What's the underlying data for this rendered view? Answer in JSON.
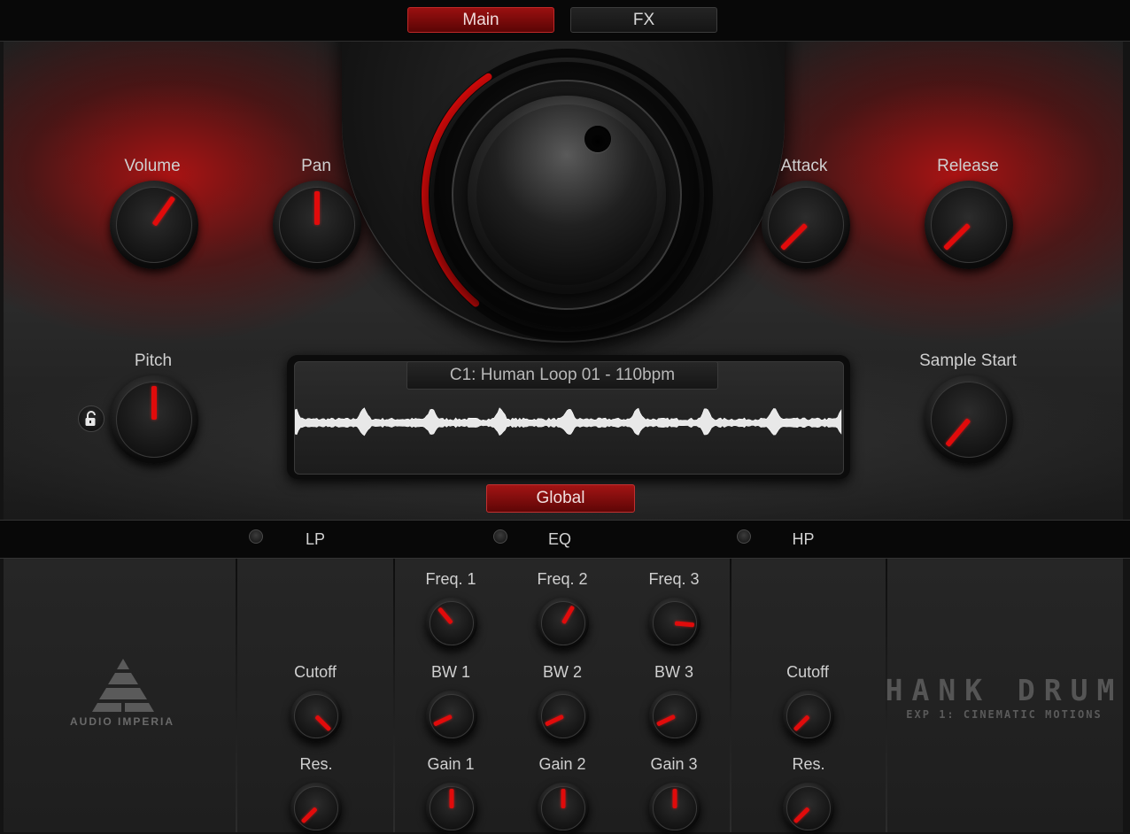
{
  "tabs": {
    "main": "Main",
    "fx": "FX"
  },
  "knobs": {
    "volume": {
      "label": "Volume",
      "angle": 35
    },
    "pan": {
      "label": "Pan",
      "angle": 0
    },
    "attack": {
      "label": "Attack",
      "angle": -135
    },
    "release": {
      "label": "Release",
      "angle": -135
    },
    "pitch": {
      "label": "Pitch",
      "angle": 0
    },
    "sample_start": {
      "label": "Sample Start",
      "angle": -140
    }
  },
  "big_knob": {
    "value_fraction": 0.38
  },
  "sample": {
    "name": "C1: Human Loop 01 - 110bpm"
  },
  "global_button": "Global",
  "sections": {
    "lp": "LP",
    "eq": "EQ",
    "hp": "HP"
  },
  "lp": {
    "cutoff": {
      "label": "Cutoff",
      "angle": 135
    },
    "res": {
      "label": "Res.",
      "angle": -135
    }
  },
  "eq": {
    "freq1": {
      "label": "Freq. 1",
      "angle": -40
    },
    "freq2": {
      "label": "Freq. 2",
      "angle": 30
    },
    "freq3": {
      "label": "Freq. 3",
      "angle": 95
    },
    "bw1": {
      "label": "BW 1",
      "angle": -115
    },
    "bw2": {
      "label": "BW 2",
      "angle": -115
    },
    "bw3": {
      "label": "BW 3",
      "angle": -115
    },
    "gain1": {
      "label": "Gain 1",
      "angle": 0
    },
    "gain2": {
      "label": "Gain 2",
      "angle": 0
    },
    "gain3": {
      "label": "Gain 3",
      "angle": 0
    }
  },
  "hp": {
    "cutoff": {
      "label": "Cutoff",
      "angle": -135
    },
    "res": {
      "label": "Res.",
      "angle": -135
    }
  },
  "logos": {
    "audio_imperia": "AUDIO IMPERIA",
    "product": "HANK DRUM",
    "product_sub": "EXP 1: CINEMATIC MOTIONS"
  },
  "colors": {
    "accent": "#e10b0b",
    "panel": "#1c1c1c"
  }
}
